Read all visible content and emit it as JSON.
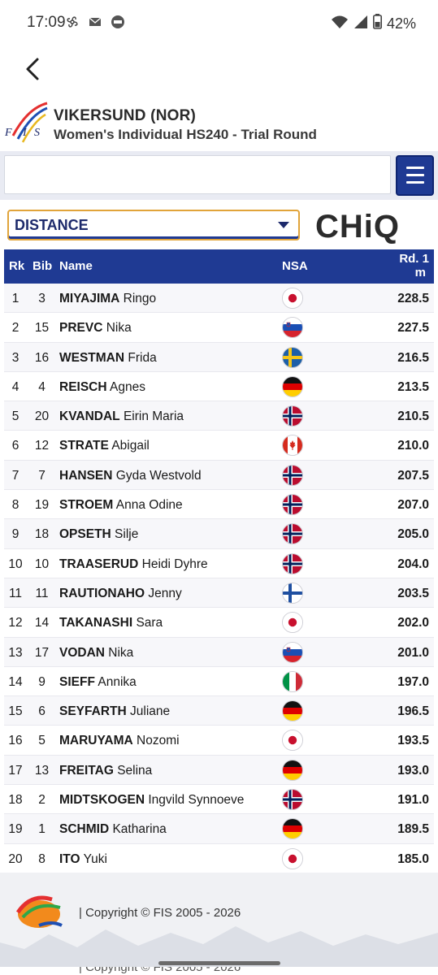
{
  "status": {
    "time": "17:09",
    "battery": "42%"
  },
  "header": {
    "location": "VIKERSUND (NOR)",
    "event": "Women's Individual HS240 - Trial Round"
  },
  "search": {
    "value": "",
    "placeholder": ""
  },
  "selector": {
    "value": "DISTANCE"
  },
  "sponsor": {
    "name": "CHiQ"
  },
  "table": {
    "headers": {
      "rk": "Rk",
      "bib": "Bib",
      "name": "Name",
      "nsa": "NSA",
      "dist_line1": "Rd. 1",
      "dist_line2": "m"
    },
    "rows": [
      {
        "rk": "1",
        "bib": "3",
        "last": "MIYAJIMA",
        "first": "Ringo",
        "nsa": "JPN",
        "dist": "228.5"
      },
      {
        "rk": "2",
        "bib": "15",
        "last": "PREVC",
        "first": "Nika",
        "nsa": "SLO",
        "dist": "227.5"
      },
      {
        "rk": "3",
        "bib": "16",
        "last": "WESTMAN",
        "first": "Frida",
        "nsa": "SWE",
        "dist": "216.5"
      },
      {
        "rk": "4",
        "bib": "4",
        "last": "REISCH",
        "first": "Agnes",
        "nsa": "GER",
        "dist": "213.5"
      },
      {
        "rk": "5",
        "bib": "20",
        "last": "KVANDAL",
        "first": "Eirin Maria",
        "nsa": "NOR",
        "dist": "210.5"
      },
      {
        "rk": "6",
        "bib": "12",
        "last": "STRATE",
        "first": "Abigail",
        "nsa": "CAN",
        "dist": "210.0"
      },
      {
        "rk": "7",
        "bib": "7",
        "last": "HANSEN",
        "first": "Gyda Westvold",
        "nsa": "NOR",
        "dist": "207.5"
      },
      {
        "rk": "8",
        "bib": "19",
        "last": "STROEM",
        "first": "Anna Odine",
        "nsa": "NOR",
        "dist": "207.0"
      },
      {
        "rk": "9",
        "bib": "18",
        "last": "OPSETH",
        "first": "Silje",
        "nsa": "NOR",
        "dist": "205.0"
      },
      {
        "rk": "10",
        "bib": "10",
        "last": "TRAASERUD",
        "first": "Heidi Dyhre",
        "nsa": "NOR",
        "dist": "204.0"
      },
      {
        "rk": "11",
        "bib": "11",
        "last": "RAUTIONAHO",
        "first": "Jenny",
        "nsa": "FIN",
        "dist": "203.5"
      },
      {
        "rk": "12",
        "bib": "14",
        "last": "TAKANASHI",
        "first": "Sara",
        "nsa": "JPN",
        "dist": "202.0"
      },
      {
        "rk": "13",
        "bib": "17",
        "last": "VODAN",
        "first": "Nika",
        "nsa": "SLO",
        "dist": "201.0"
      },
      {
        "rk": "14",
        "bib": "9",
        "last": "SIEFF",
        "first": "Annika",
        "nsa": "ITA",
        "dist": "197.0"
      },
      {
        "rk": "15",
        "bib": "6",
        "last": "SEYFARTH",
        "first": "Juliane",
        "nsa": "GER",
        "dist": "196.5"
      },
      {
        "rk": "16",
        "bib": "5",
        "last": "MARUYAMA",
        "first": "Nozomi",
        "nsa": "JPN",
        "dist": "193.5"
      },
      {
        "rk": "17",
        "bib": "13",
        "last": "FREITAG",
        "first": "Selina",
        "nsa": "GER",
        "dist": "193.0"
      },
      {
        "rk": "18",
        "bib": "2",
        "last": "MIDTSKOGEN",
        "first": "Ingvild Synnoeve",
        "nsa": "NOR",
        "dist": "191.0"
      },
      {
        "rk": "19",
        "bib": "1",
        "last": "SCHMID",
        "first": "Katharina",
        "nsa": "GER",
        "dist": "189.5"
      },
      {
        "rk": "20",
        "bib": "8",
        "last": "ITO",
        "first": "Yuki",
        "nsa": "JPN",
        "dist": "185.0"
      }
    ]
  },
  "footer": {
    "copyright": "| Copyright © FIS 2005 - 2026"
  },
  "colors": {
    "primary": "#1f3a93",
    "accent": "#e1a43a"
  }
}
